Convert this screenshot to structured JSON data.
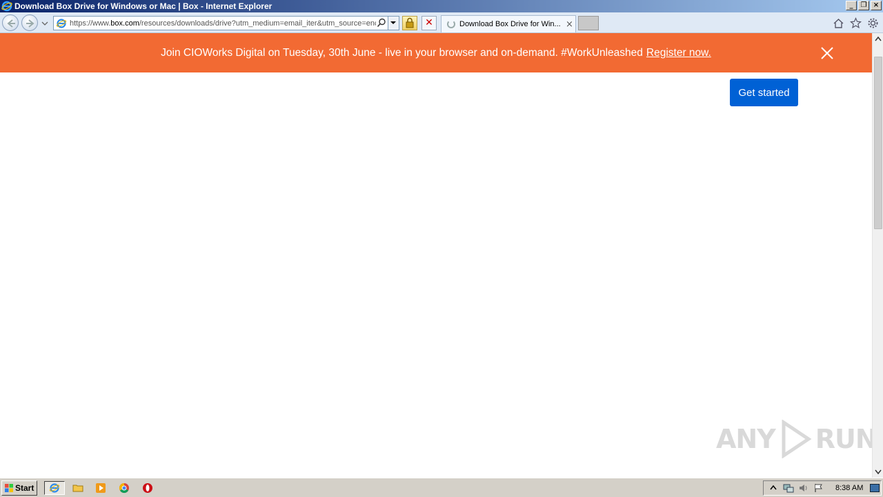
{
  "window": {
    "title": "Download Box Drive for Windows or Mac | Box - Internet Explorer",
    "buttons": {
      "minimize": "_",
      "restore": "❐",
      "close": "×"
    }
  },
  "navbar": {
    "url_scheme": "https://www.",
    "url_host": "box.com",
    "url_path": "/resources/downloads/drive?utm_medium=email_iter&utm_source=enc",
    "tab_label": "Download Box Drive for Win...",
    "tab_close": "×"
  },
  "banner": {
    "text": "Join CIOWorks Digital on Tuesday, 30th June - live in your browser and on-demand. #WorkUnleashed",
    "link": "Register now.",
    "background": "#f26a33"
  },
  "page": {
    "cta_label": "Get started",
    "cta_color": "#0061d5"
  },
  "watermark": {
    "left": "ANY",
    "right": "RUN"
  },
  "taskbar": {
    "start_label": "Start",
    "clock": "8:38 AM",
    "icons": [
      "internet-explorer-icon",
      "folder-icon",
      "media-player-icon",
      "chrome-icon",
      "opera-icon"
    ]
  }
}
